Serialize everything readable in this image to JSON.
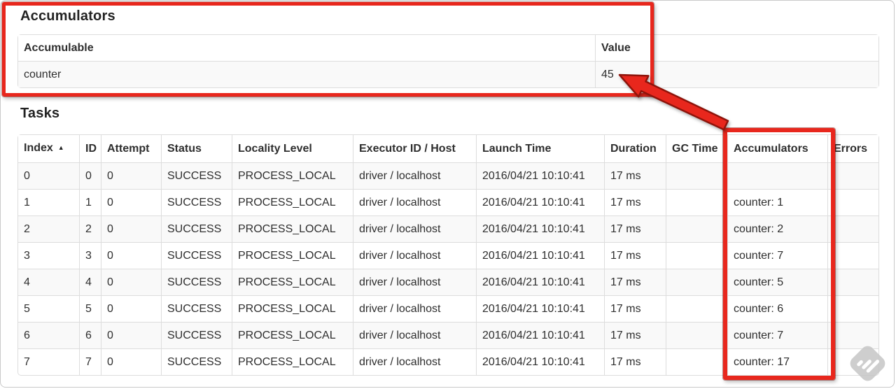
{
  "colors": {
    "annotation_red": "#e8271d",
    "table_border": "#dddddd",
    "row_stripe": "#f9f9f9",
    "text": "#2e2e2e"
  },
  "accumulators_section": {
    "title": "Accumulators",
    "table": {
      "headers": [
        {
          "label": "Accumulable"
        },
        {
          "label": "Value"
        }
      ],
      "rows": [
        [
          "counter",
          "45"
        ]
      ]
    }
  },
  "tasks_section": {
    "title": "Tasks",
    "table": {
      "headers": [
        {
          "label": "Index",
          "sort": "▲"
        },
        {
          "label": "ID"
        },
        {
          "label": "Attempt"
        },
        {
          "label": "Status"
        },
        {
          "label": "Locality Level"
        },
        {
          "label": "Executor ID / Host"
        },
        {
          "label": "Launch Time"
        },
        {
          "label": "Duration"
        },
        {
          "label": "GC Time"
        },
        {
          "label": "Accumulators"
        },
        {
          "label": "Errors"
        }
      ],
      "rows": [
        [
          "0",
          "0",
          "0",
          "SUCCESS",
          "PROCESS_LOCAL",
          "driver / localhost",
          "2016/04/21 10:10:41",
          "17 ms",
          "",
          "",
          ""
        ],
        [
          "1",
          "1",
          "0",
          "SUCCESS",
          "PROCESS_LOCAL",
          "driver / localhost",
          "2016/04/21 10:10:41",
          "17 ms",
          "",
          "counter: 1",
          ""
        ],
        [
          "2",
          "2",
          "0",
          "SUCCESS",
          "PROCESS_LOCAL",
          "driver / localhost",
          "2016/04/21 10:10:41",
          "17 ms",
          "",
          "counter: 2",
          ""
        ],
        [
          "3",
          "3",
          "0",
          "SUCCESS",
          "PROCESS_LOCAL",
          "driver / localhost",
          "2016/04/21 10:10:41",
          "17 ms",
          "",
          "counter: 7",
          ""
        ],
        [
          "4",
          "4",
          "0",
          "SUCCESS",
          "PROCESS_LOCAL",
          "driver / localhost",
          "2016/04/21 10:10:41",
          "17 ms",
          "",
          "counter: 5",
          ""
        ],
        [
          "5",
          "5",
          "0",
          "SUCCESS",
          "PROCESS_LOCAL",
          "driver / localhost",
          "2016/04/21 10:10:41",
          "17 ms",
          "",
          "counter: 6",
          ""
        ],
        [
          "6",
          "6",
          "0",
          "SUCCESS",
          "PROCESS_LOCAL",
          "driver / localhost",
          "2016/04/21 10:10:41",
          "17 ms",
          "",
          "counter: 7",
          ""
        ],
        [
          "7",
          "7",
          "0",
          "SUCCESS",
          "PROCESS_LOCAL",
          "driver / localhost",
          "2016/04/21 10:10:41",
          "17 ms",
          "",
          "counter: 17",
          ""
        ]
      ]
    }
  }
}
